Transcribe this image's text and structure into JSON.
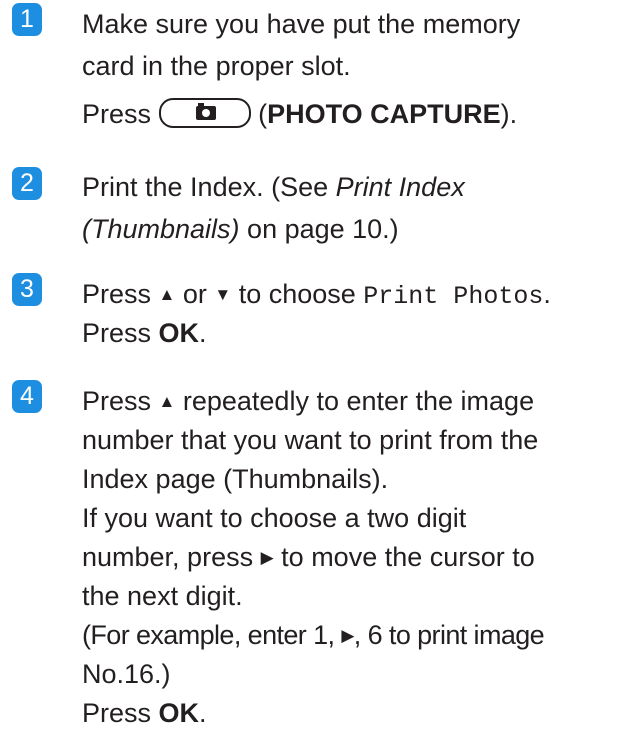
{
  "steps": [
    {
      "number": "1",
      "lines": [
        "Make sure you have put the memory",
        "card in the proper slot."
      ],
      "press_prefix": "Press",
      "photo_capture_open": "(",
      "photo_capture_label": "PHOTO CAPTURE",
      "photo_capture_close": ")."
    },
    {
      "number": "2",
      "line1_a": "Print the Index. (See ",
      "line1_italic": "Print Index",
      "line2_italic": "(Thumbnails)",
      "line2_b": " on page 10.)"
    },
    {
      "number": "3",
      "press": "Press ",
      "up_arrow": "▲",
      "or": " or ",
      "down_arrow": "▼",
      "to_choose": " to choose ",
      "menu_item": "Print Photos",
      "period": ".",
      "press2": "Press ",
      "ok": "OK",
      "period2": "."
    },
    {
      "number": "4",
      "l1_a": "Press ",
      "l1_arrow": "▲",
      "l1_b": " repeatedly to enter the image",
      "l2": "number that you want to print from the",
      "l3": "Index page (Thumbnails).",
      "l4": "If you want to choose a two digit",
      "l5_a": "number, press ",
      "l5_arrow": "▶",
      "l5_b": " to move the cursor to",
      "l6": "the next digit.",
      "l7_a": "(For example, enter 1, ",
      "l7_arrow": "▶",
      "l7_b": ", 6 to print image",
      "l8": "No.16.)",
      "l9_a": "Press ",
      "l9_ok": "OK",
      "l9_b": "."
    }
  ],
  "colors": {
    "badge": "#1e8fe0",
    "text": "#231f20"
  },
  "icons": {
    "photo_capture_button": "camera-icon"
  }
}
